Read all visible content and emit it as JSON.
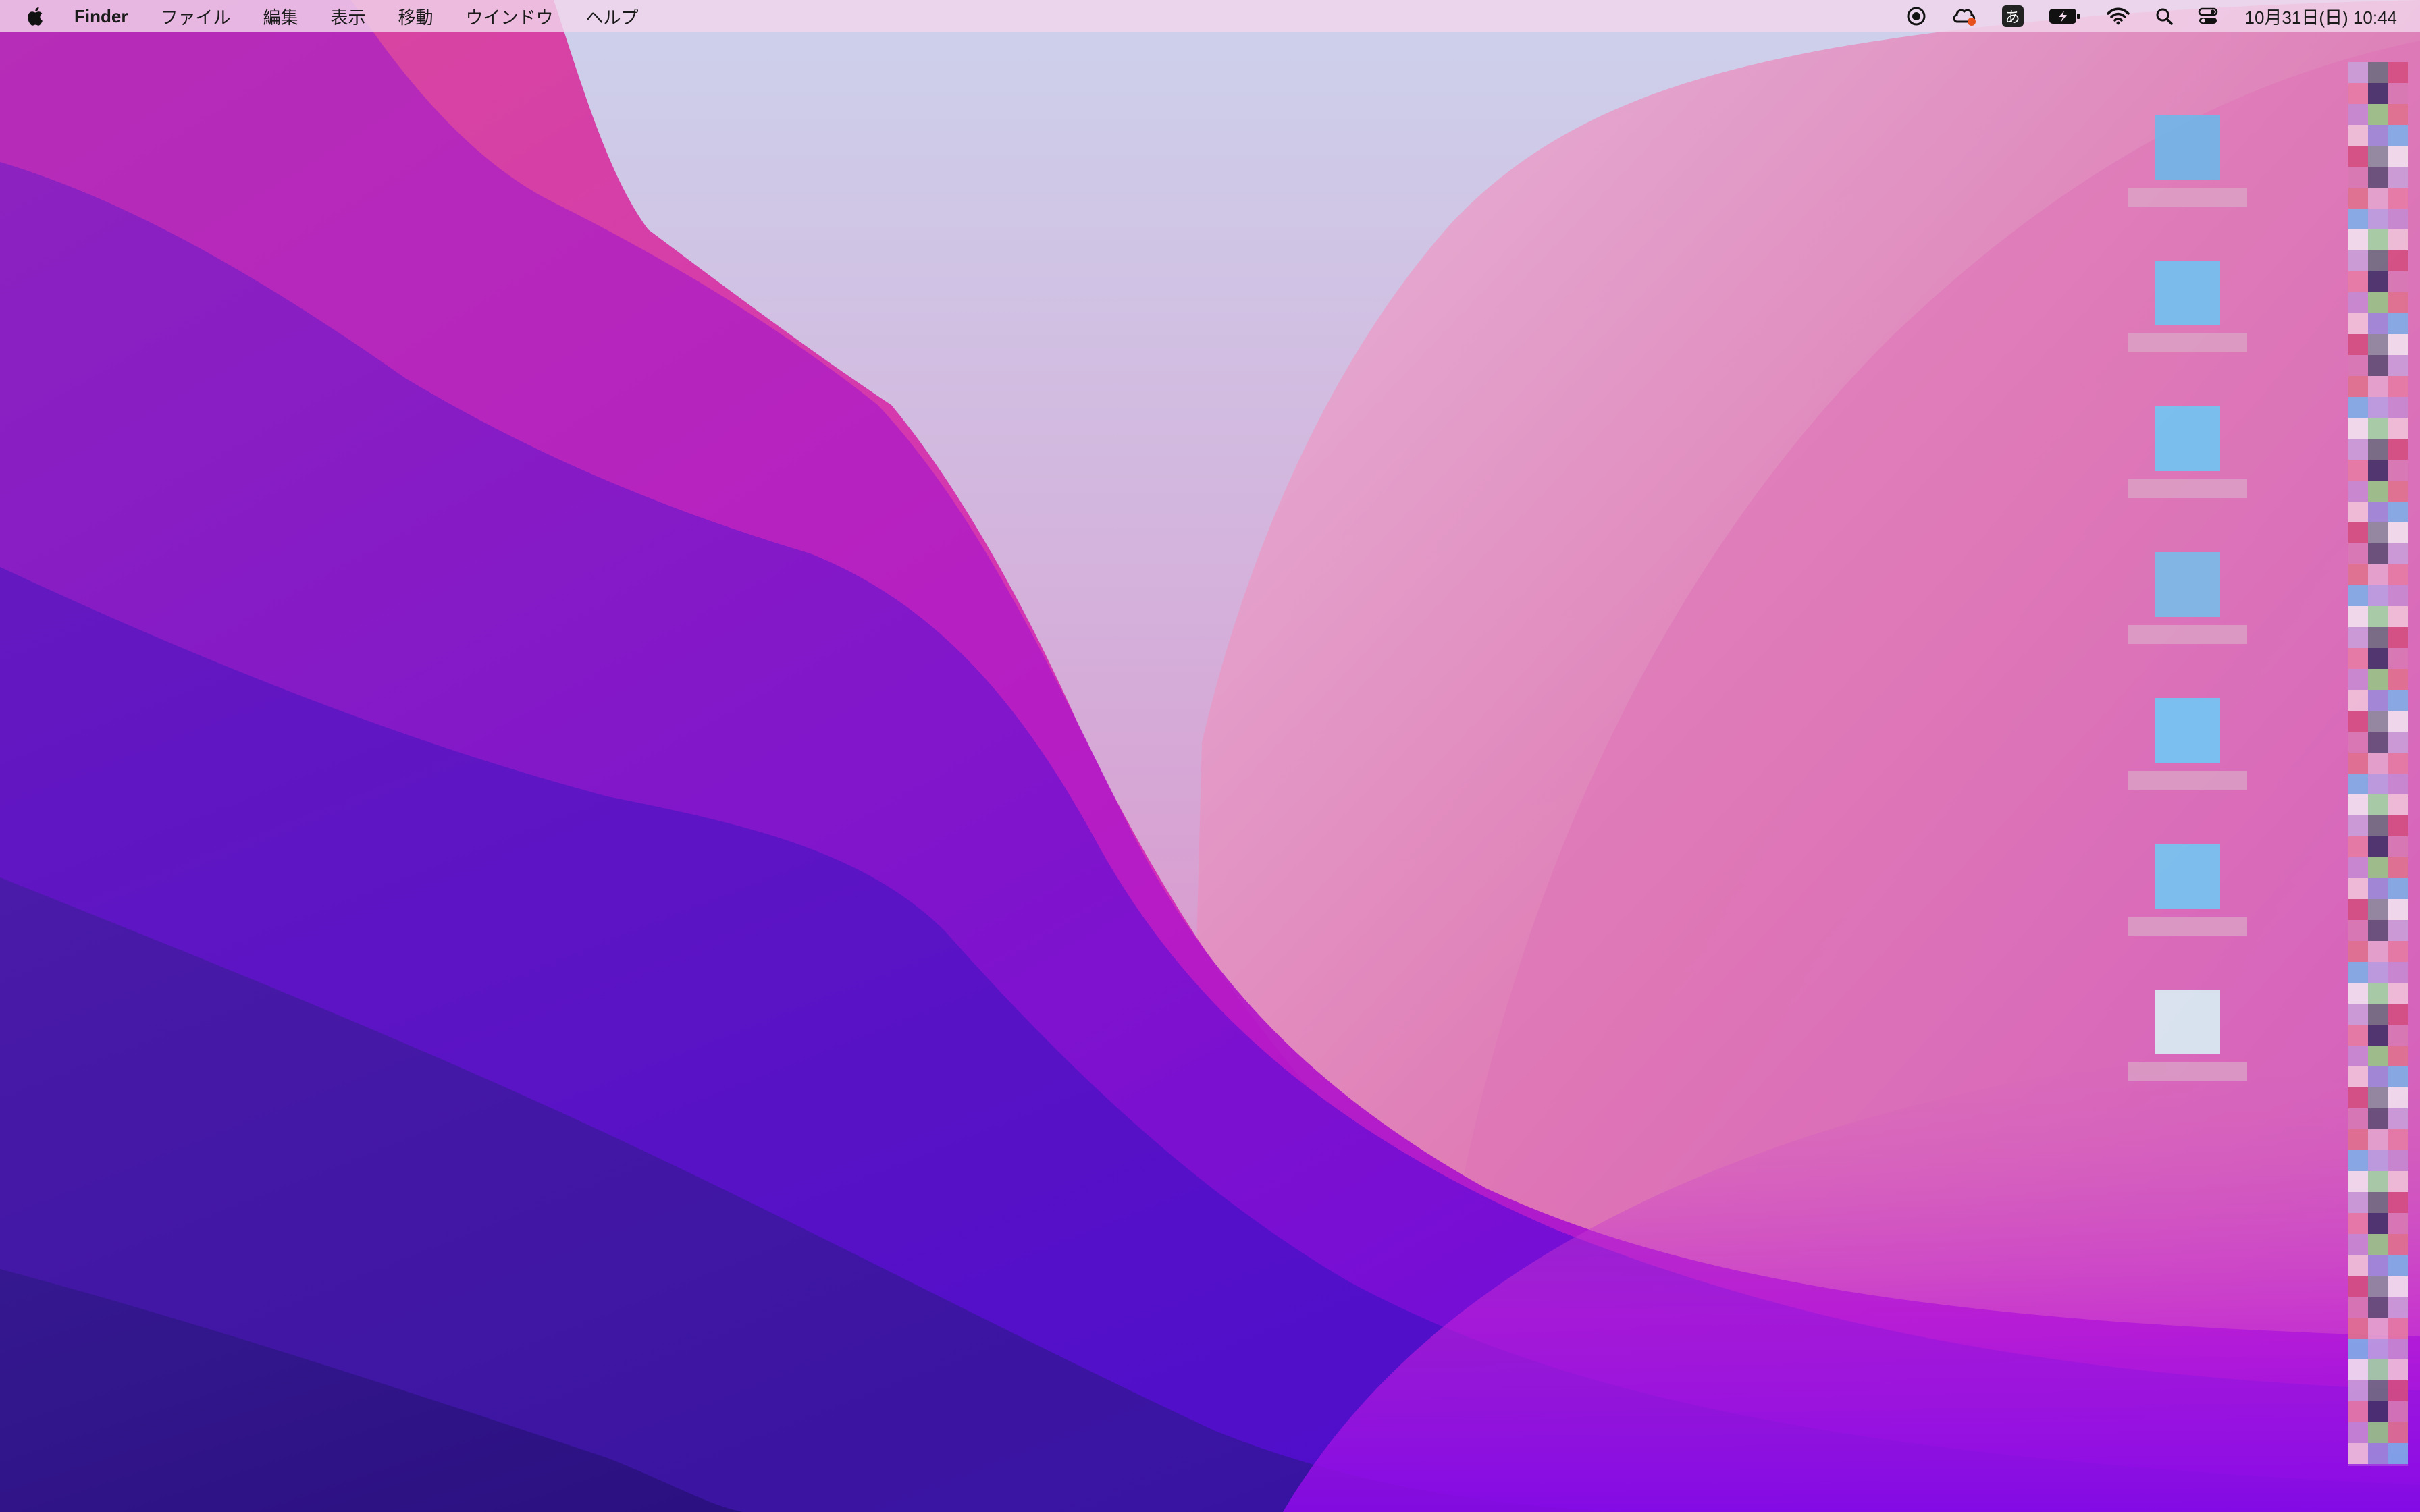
{
  "menubar": {
    "apple_icon": "apple-logo-icon",
    "app_name": "Finder",
    "menus": [
      "ファイル",
      "編集",
      "表示",
      "移動",
      "ウインドウ",
      "ヘルプ"
    ],
    "status_icons": [
      {
        "name": "record-icon"
      },
      {
        "name": "creative-cloud-icon"
      },
      {
        "name": "input-method-icon",
        "label": "あ"
      },
      {
        "name": "battery-icon"
      },
      {
        "name": "wifi-icon"
      },
      {
        "name": "spotlight-search-icon"
      },
      {
        "name": "control-center-icon"
      }
    ],
    "clock": "10月31日(日) 10:44"
  },
  "desktop": {
    "icons": [
      {
        "name": "desktop-file-1",
        "label": "",
        "tint": "#6fb7ea"
      },
      {
        "name": "desktop-file-2",
        "label": "",
        "tint": "#6fc2f2"
      },
      {
        "name": "desktop-file-3",
        "label": "",
        "tint": "#6fc6f4"
      },
      {
        "name": "desktop-file-4",
        "label": "",
        "tint": "#78bde8"
      },
      {
        "name": "desktop-file-5",
        "label": "",
        "tint": "#6fc8f6"
      },
      {
        "name": "desktop-file-6",
        "label": "",
        "tint": "#72c6f3"
      },
      {
        "name": "desktop-file-7",
        "label": "",
        "tint": "#d8f0f4"
      }
    ]
  },
  "colors": {
    "menubar_bg": "#f2d6ec",
    "wallpaper_top": "#e6c8e6",
    "wallpaper_mid": "#d85ab6",
    "wallpaper_bottom": "#4a12a8"
  }
}
